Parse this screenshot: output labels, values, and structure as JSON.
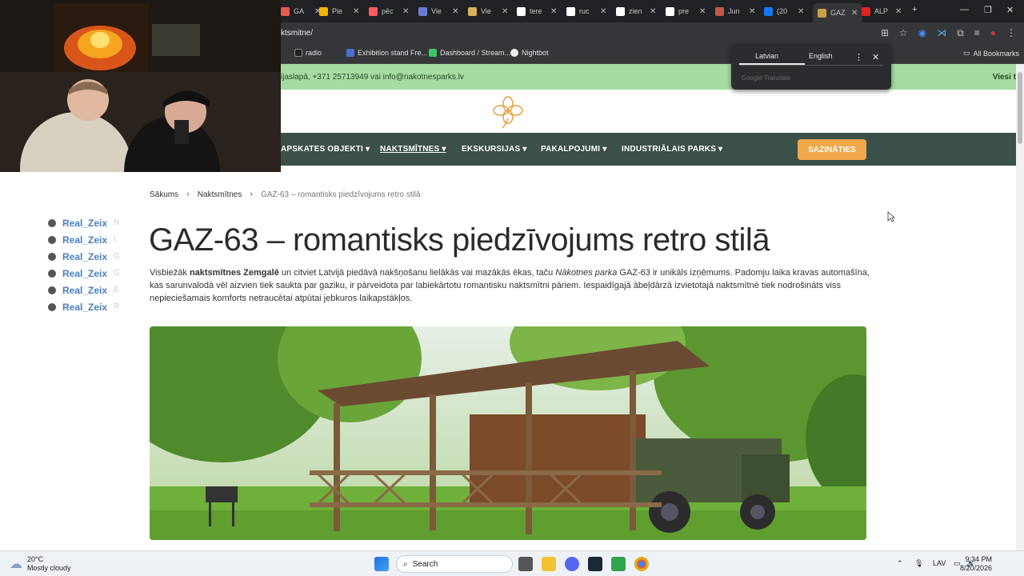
{
  "browser": {
    "tabs": [
      {
        "label": "GA",
        "color": "#e85a4f"
      },
      {
        "label": "Pie",
        "color": "#f5b400"
      },
      {
        "label": "pēc",
        "color": "#ff5a5f"
      },
      {
        "label": "Vie",
        "color": "#6a7bd5"
      },
      {
        "label": "Vie",
        "color": "#d8b15a"
      },
      {
        "label": "tere",
        "color": "#ffffff"
      },
      {
        "label": "ruc",
        "color": "#ffffff"
      },
      {
        "label": "zien",
        "color": "#ffffff"
      },
      {
        "label": "pre",
        "color": "#ffffff"
      },
      {
        "label": "Jun",
        "color": "#c05a4a"
      },
      {
        "label": "(20",
        "color": "#1877f2"
      },
      {
        "label": "GAZ",
        "color": "#c9a24a",
        "active": true
      },
      {
        "label": "ALP",
        "color": "#d22"
      }
    ],
    "url": "ktsmitne/",
    "bookmarks": [
      "radio",
      "Exhibition stand Fre...",
      "Dashboard / Stream...",
      "Nightbot"
    ],
    "all_bookmarks": "All Bookmarks",
    "translate": {
      "lang_from": "Latvian",
      "lang_to": "English",
      "footer": "Google Translate"
    }
  },
  "site": {
    "topbar": {
      "contact": "ijaslapā, +371 25713949 vai info@nakotnesparks.lv",
      "right": "Viesi t"
    },
    "nav": [
      {
        "label": "APSKATES OBJEKTI",
        "active": false
      },
      {
        "label": "NAKTSMĪTNES",
        "active": true
      },
      {
        "label": "EKSKURSIJAS",
        "active": false
      },
      {
        "label": "PAKALPOJUMI",
        "active": false
      },
      {
        "label": "INDUSTRIĀLAIS PARKS",
        "active": false
      }
    ],
    "cta": "SAZINĀTIES",
    "breadcrumb": {
      "home": "Sākums",
      "section": "Naktsmītnes",
      "current": "GAZ-63 – romantisks piedzīvojums retro stilā"
    },
    "title": "GAZ-63 – romantisks piedzīvojums retro stilā",
    "intro": {
      "p1": "Visbiežāk ",
      "b1": "naktsmītnes Zemgalē",
      "p2": " un citviet Latvijā piedāvā nakšņošanu lielākās vai mazākās ēkas, taču ",
      "i1": "Nākotnes parka",
      "p3": " GAZ-63 ir unikāls izņēmums. Padomju laika kravas automašīna, kas sarunvalodā vēl aizvien tiek saukta par gaziku, ir pārveidota par labiekārtotu romantisku naktsmītni pāriem. Iespaidīgajā ābeļdārzā izvietotajā naktsmītnē tiek nodrošināts viss nepieciešamais komforts netraucētai atpūtai jebkuros laikapstākļos."
    }
  },
  "chat": [
    {
      "user": "Real_Zeix",
      "msg": "N"
    },
    {
      "user": "Real_Zeix",
      "msg": "I"
    },
    {
      "user": "Real_Zeix",
      "msg": "G"
    },
    {
      "user": "Real_Zeix",
      "msg": "G"
    },
    {
      "user": "Real_Zeix",
      "msg": "E"
    },
    {
      "user": "Real_Zeix",
      "msg": "R"
    }
  ],
  "taskbar": {
    "weather_temp": "20°C",
    "weather_desc": "Mostly cloudy",
    "search": "Search",
    "lang": "LAV",
    "time": "9:34 PM",
    "date": "8/20/2026"
  }
}
